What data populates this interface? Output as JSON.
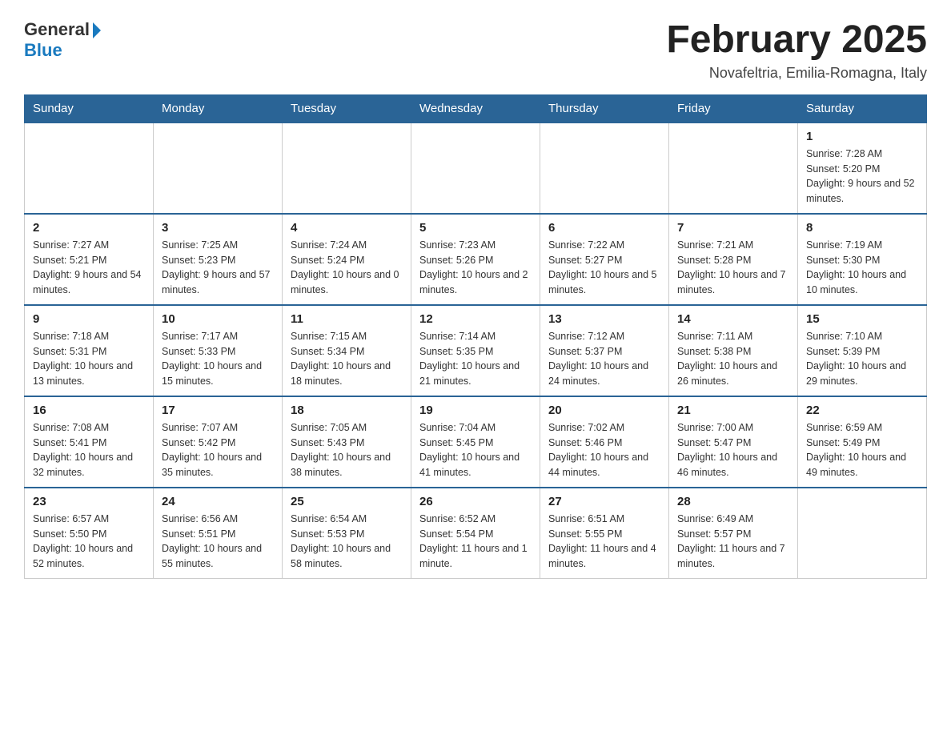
{
  "header": {
    "logo_general": "General",
    "logo_blue": "Blue",
    "month_title": "February 2025",
    "location": "Novafeltria, Emilia-Romagna, Italy"
  },
  "days_of_week": [
    "Sunday",
    "Monday",
    "Tuesday",
    "Wednesday",
    "Thursday",
    "Friday",
    "Saturday"
  ],
  "weeks": [
    [
      {
        "day": "",
        "info": ""
      },
      {
        "day": "",
        "info": ""
      },
      {
        "day": "",
        "info": ""
      },
      {
        "day": "",
        "info": ""
      },
      {
        "day": "",
        "info": ""
      },
      {
        "day": "",
        "info": ""
      },
      {
        "day": "1",
        "info": "Sunrise: 7:28 AM\nSunset: 5:20 PM\nDaylight: 9 hours and 52 minutes."
      }
    ],
    [
      {
        "day": "2",
        "info": "Sunrise: 7:27 AM\nSunset: 5:21 PM\nDaylight: 9 hours and 54 minutes."
      },
      {
        "day": "3",
        "info": "Sunrise: 7:25 AM\nSunset: 5:23 PM\nDaylight: 9 hours and 57 minutes."
      },
      {
        "day": "4",
        "info": "Sunrise: 7:24 AM\nSunset: 5:24 PM\nDaylight: 10 hours and 0 minutes."
      },
      {
        "day": "5",
        "info": "Sunrise: 7:23 AM\nSunset: 5:26 PM\nDaylight: 10 hours and 2 minutes."
      },
      {
        "day": "6",
        "info": "Sunrise: 7:22 AM\nSunset: 5:27 PM\nDaylight: 10 hours and 5 minutes."
      },
      {
        "day": "7",
        "info": "Sunrise: 7:21 AM\nSunset: 5:28 PM\nDaylight: 10 hours and 7 minutes."
      },
      {
        "day": "8",
        "info": "Sunrise: 7:19 AM\nSunset: 5:30 PM\nDaylight: 10 hours and 10 minutes."
      }
    ],
    [
      {
        "day": "9",
        "info": "Sunrise: 7:18 AM\nSunset: 5:31 PM\nDaylight: 10 hours and 13 minutes."
      },
      {
        "day": "10",
        "info": "Sunrise: 7:17 AM\nSunset: 5:33 PM\nDaylight: 10 hours and 15 minutes."
      },
      {
        "day": "11",
        "info": "Sunrise: 7:15 AM\nSunset: 5:34 PM\nDaylight: 10 hours and 18 minutes."
      },
      {
        "day": "12",
        "info": "Sunrise: 7:14 AM\nSunset: 5:35 PM\nDaylight: 10 hours and 21 minutes."
      },
      {
        "day": "13",
        "info": "Sunrise: 7:12 AM\nSunset: 5:37 PM\nDaylight: 10 hours and 24 minutes."
      },
      {
        "day": "14",
        "info": "Sunrise: 7:11 AM\nSunset: 5:38 PM\nDaylight: 10 hours and 26 minutes."
      },
      {
        "day": "15",
        "info": "Sunrise: 7:10 AM\nSunset: 5:39 PM\nDaylight: 10 hours and 29 minutes."
      }
    ],
    [
      {
        "day": "16",
        "info": "Sunrise: 7:08 AM\nSunset: 5:41 PM\nDaylight: 10 hours and 32 minutes."
      },
      {
        "day": "17",
        "info": "Sunrise: 7:07 AM\nSunset: 5:42 PM\nDaylight: 10 hours and 35 minutes."
      },
      {
        "day": "18",
        "info": "Sunrise: 7:05 AM\nSunset: 5:43 PM\nDaylight: 10 hours and 38 minutes."
      },
      {
        "day": "19",
        "info": "Sunrise: 7:04 AM\nSunset: 5:45 PM\nDaylight: 10 hours and 41 minutes."
      },
      {
        "day": "20",
        "info": "Sunrise: 7:02 AM\nSunset: 5:46 PM\nDaylight: 10 hours and 44 minutes."
      },
      {
        "day": "21",
        "info": "Sunrise: 7:00 AM\nSunset: 5:47 PM\nDaylight: 10 hours and 46 minutes."
      },
      {
        "day": "22",
        "info": "Sunrise: 6:59 AM\nSunset: 5:49 PM\nDaylight: 10 hours and 49 minutes."
      }
    ],
    [
      {
        "day": "23",
        "info": "Sunrise: 6:57 AM\nSunset: 5:50 PM\nDaylight: 10 hours and 52 minutes."
      },
      {
        "day": "24",
        "info": "Sunrise: 6:56 AM\nSunset: 5:51 PM\nDaylight: 10 hours and 55 minutes."
      },
      {
        "day": "25",
        "info": "Sunrise: 6:54 AM\nSunset: 5:53 PM\nDaylight: 10 hours and 58 minutes."
      },
      {
        "day": "26",
        "info": "Sunrise: 6:52 AM\nSunset: 5:54 PM\nDaylight: 11 hours and 1 minute."
      },
      {
        "day": "27",
        "info": "Sunrise: 6:51 AM\nSunset: 5:55 PM\nDaylight: 11 hours and 4 minutes."
      },
      {
        "day": "28",
        "info": "Sunrise: 6:49 AM\nSunset: 5:57 PM\nDaylight: 11 hours and 7 minutes."
      },
      {
        "day": "",
        "info": ""
      }
    ]
  ]
}
